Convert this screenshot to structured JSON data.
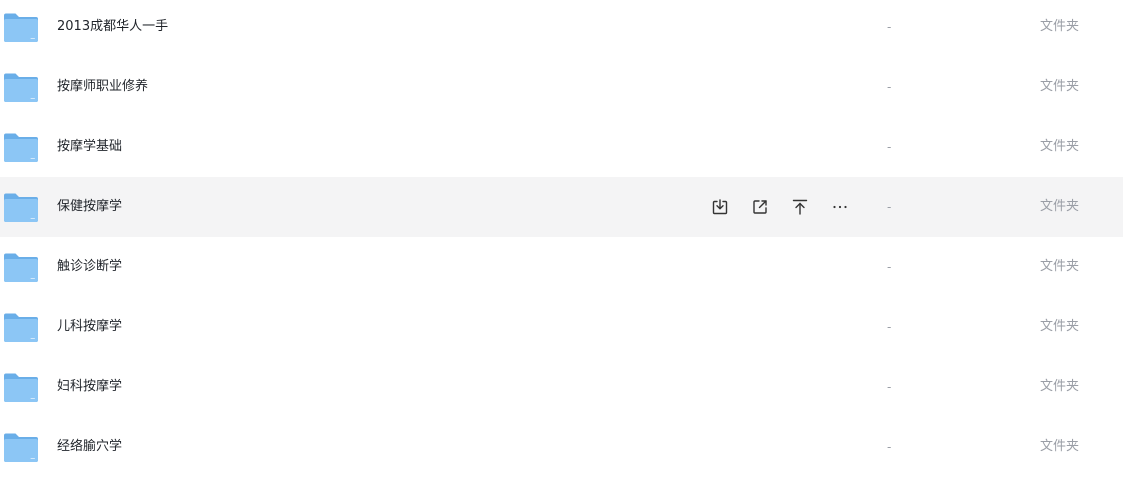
{
  "file_list": {
    "rows": [
      {
        "name": "2013成都华人一手",
        "size": "-",
        "type": "文件夹",
        "icon": "folder-icon"
      },
      {
        "name": "按摩师职业修养",
        "size": "-",
        "type": "文件夹",
        "icon": "folder-icon"
      },
      {
        "name": "按摩学基础",
        "size": "-",
        "type": "文件夹",
        "icon": "folder-icon"
      },
      {
        "name": "保健按摩学",
        "size": "-",
        "type": "文件夹",
        "icon": "folder-icon",
        "hovered": true
      },
      {
        "name": "触诊诊断学",
        "size": "-",
        "type": "文件夹",
        "icon": "folder-icon"
      },
      {
        "name": "儿科按摩学",
        "size": "-",
        "type": "文件夹",
        "icon": "folder-icon"
      },
      {
        "name": "妇科按摩学",
        "size": "-",
        "type": "文件夹",
        "icon": "folder-icon"
      },
      {
        "name": "经络腧穴学",
        "size": "-",
        "type": "文件夹",
        "icon": "folder-icon"
      }
    ],
    "hover_actions": [
      "download-icon",
      "share-icon",
      "pin-to-top-icon",
      "more-icon"
    ]
  },
  "colors": {
    "folder_back": "#6aaee8",
    "folder_front": "#8cc6f5",
    "hover_bg": "#f4f4f5",
    "action_icon": "#333333"
  }
}
